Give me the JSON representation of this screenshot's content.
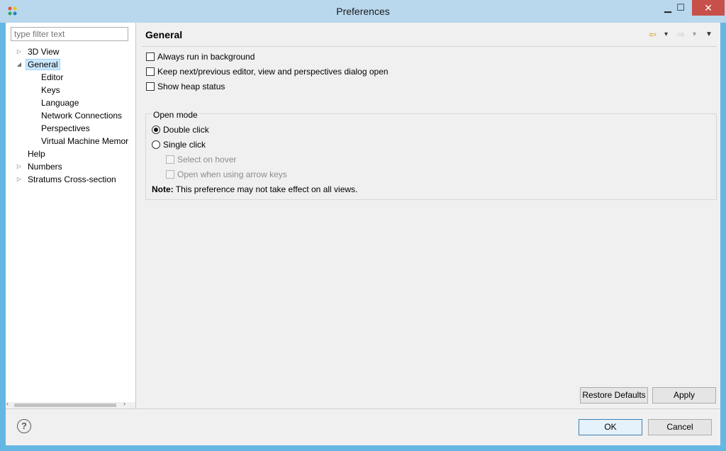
{
  "window": {
    "title": "Preferences",
    "minimize_glyph": "▁",
    "maximize_glyph": "☐",
    "close_glyph": "✕"
  },
  "filter": {
    "placeholder": "type filter text",
    "value": ""
  },
  "tree": {
    "items": [
      {
        "label": "3D View",
        "arrow": "▷",
        "level": 0
      },
      {
        "label": "General",
        "arrow": "◢",
        "level": 0,
        "selected": true
      },
      {
        "label": "Editor",
        "arrow": "",
        "level": 1
      },
      {
        "label": "Keys",
        "arrow": "",
        "level": 1
      },
      {
        "label": "Language",
        "arrow": "",
        "level": 1
      },
      {
        "label": "Network Connections",
        "arrow": "",
        "level": 1
      },
      {
        "label": "Perspectives",
        "arrow": "",
        "level": 1
      },
      {
        "label": "Virtual Machine Memor",
        "arrow": "",
        "level": 1
      },
      {
        "label": "Help",
        "arrow": "",
        "level": 0
      },
      {
        "label": "Numbers",
        "arrow": "▷",
        "level": 0
      },
      {
        "label": "Stratums Cross-section",
        "arrow": "▷",
        "level": 0
      }
    ],
    "scroll_left": "‹",
    "scroll_right": "›"
  },
  "page": {
    "title": "General",
    "options": [
      {
        "label": "Always run in background",
        "checked": false
      },
      {
        "label": "Keep next/previous editor, view and perspectives dialog open",
        "checked": false
      },
      {
        "label": "Show heap status",
        "checked": false
      }
    ],
    "open_mode": {
      "title": "Open mode",
      "double_click": "Double click",
      "single_click": "Single click",
      "select_on_hover": "Select on hover",
      "open_arrow_keys": "Open when using arrow keys",
      "selected": "Double click"
    },
    "note_label": "Note:",
    "note_text": "This preference may not take effect on all views."
  },
  "nav": {
    "back_icon": "⇦",
    "forward_icon": "⇨",
    "dropdown_icon": "▾",
    "menu_icon": "▼"
  },
  "buttons": {
    "restore_defaults": "Restore Defaults",
    "apply": "Apply",
    "ok": "OK",
    "cancel": "Cancel",
    "help": "?"
  },
  "colors": {
    "title_bar": "#b9d7ed",
    "close_button": "#c7504a",
    "selection": "#cce8ff",
    "back_arrow": "#d9a21b",
    "forward_arrow": "#c8c8c8"
  }
}
